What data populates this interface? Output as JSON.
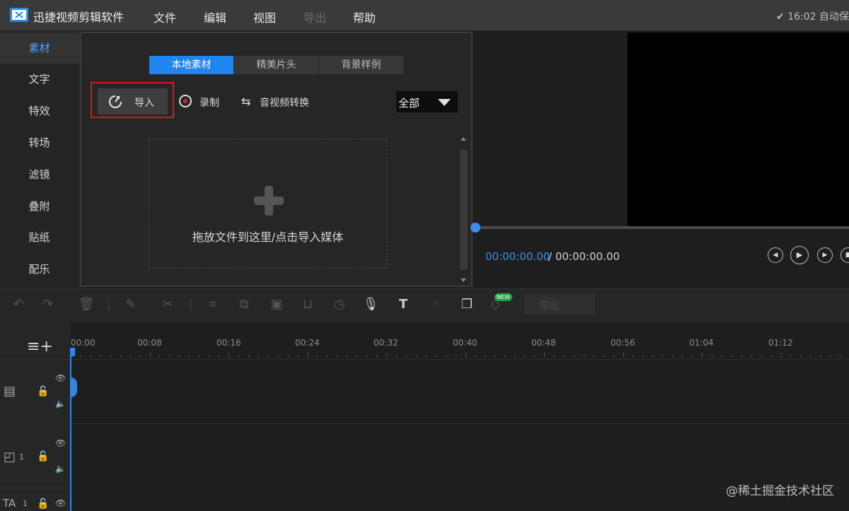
{
  "app": {
    "title": "迅捷视频剪辑软件",
    "menu": [
      "文件",
      "编辑",
      "视图",
      "导出",
      "帮助"
    ],
    "autosave": "✔ 16:02 自动保"
  },
  "sidebar": {
    "items": [
      {
        "label": "素材",
        "active": true
      },
      {
        "label": "文字"
      },
      {
        "label": "特效"
      },
      {
        "label": "转场"
      },
      {
        "label": "滤镜"
      },
      {
        "label": "叠附"
      },
      {
        "label": "贴纸"
      },
      {
        "label": "配乐"
      }
    ]
  },
  "media": {
    "tabs": [
      {
        "label": "本地素材",
        "active": true
      },
      {
        "label": "精美片头"
      },
      {
        "label": "背景样例"
      }
    ],
    "import_label": "导入",
    "record_label": "录制",
    "convert_label": "音视频转换",
    "filter_value": "全部",
    "drop_hint": "拖放文件到这里/点击导入媒体"
  },
  "preview": {
    "time_current": "00:00:00.00",
    "time_total": "/ 00:00:00.00",
    "progress": 0
  },
  "toolbar": {
    "new_badge": "NEW",
    "export_label": "导出"
  },
  "timeline": {
    "ruler": [
      "00:00",
      "00:08",
      "00:16",
      "00:24",
      "00:32",
      "00:40",
      "00:48",
      "00:56",
      "01:04",
      "01:12"
    ],
    "track_numbers": [
      "1",
      "1"
    ]
  },
  "watermark": "@稀土掘金技术社区",
  "colors": {
    "accent": "#1f85f0",
    "highlight": "#d31c1c",
    "new_badge": "#1fa34a"
  }
}
